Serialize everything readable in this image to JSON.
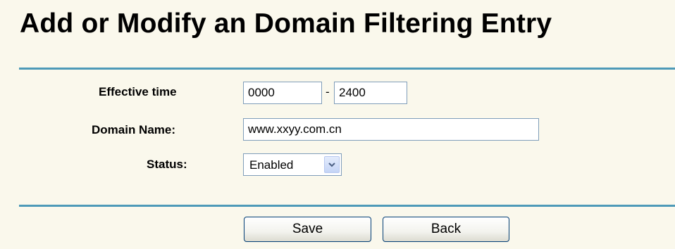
{
  "page": {
    "title": "Add or Modify an Domain Filtering Entry"
  },
  "form": {
    "effective_time": {
      "label": "Effective time",
      "start_value": "0000",
      "separator": "-",
      "end_value": "2400"
    },
    "domain_name": {
      "label": "Domain Name:",
      "value": "www.xxyy.com.cn"
    },
    "status": {
      "label": "Status:",
      "selected": "Enabled"
    }
  },
  "buttons": {
    "save_label": "Save",
    "back_label": "Back"
  },
  "colors": {
    "background": "#faf8ec",
    "rule": "#4d9ab8",
    "input_border": "#7f9db9",
    "button_border": "#003c74",
    "dropdown_arrow": "#4d6185"
  },
  "icons": {
    "status_dropdown": "chevron-down-icon"
  }
}
